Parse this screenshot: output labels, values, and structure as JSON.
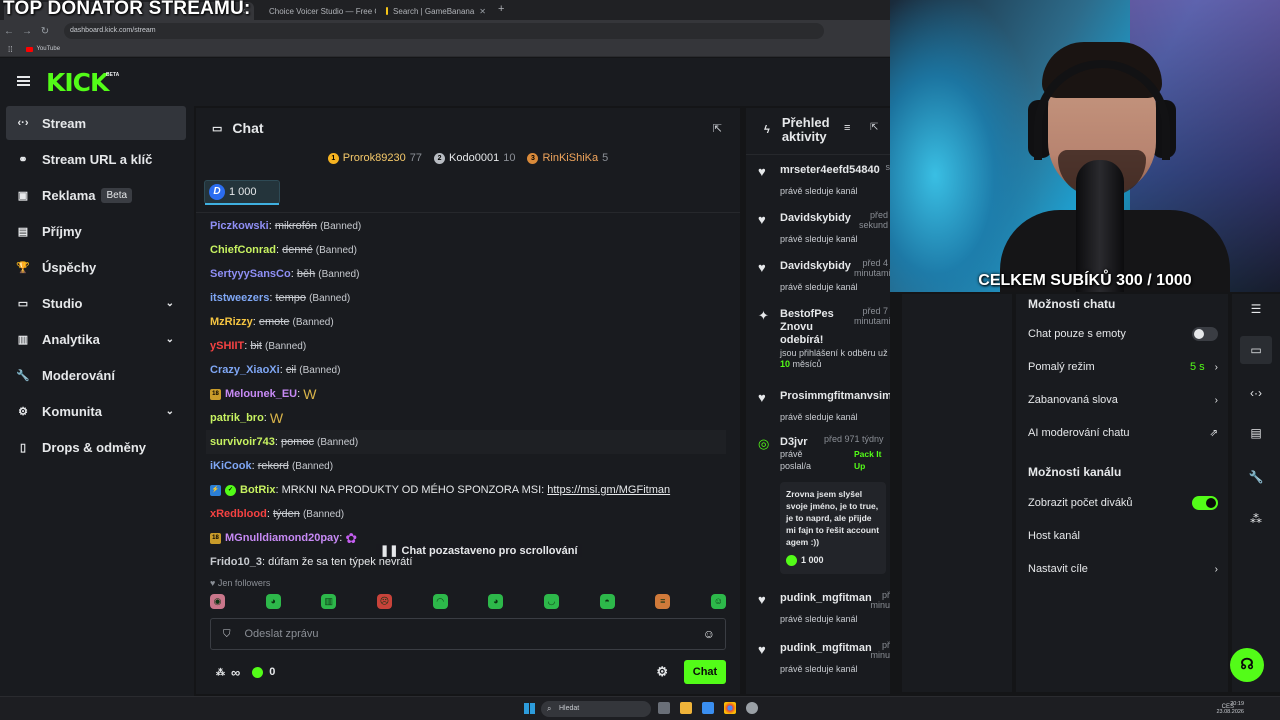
{
  "overlay": {
    "top_title": "TOP DONATOR STREAMU:",
    "subs_counter": "CELKEM SUBÍKŮ 300 / 1000"
  },
  "browser": {
    "tabs": [
      {
        "label": "",
        "active": true
      },
      {
        "label": "Choice Voicer Studio — Free C",
        "active": false
      },
      {
        "label": "Search | GameBanana",
        "active": false
      }
    ],
    "url": "dashboard.kick.com/stream",
    "bookmark": "YouTube"
  },
  "app": {
    "logo": "KICK",
    "logo_badge": "BETA"
  },
  "sidebar": {
    "items": [
      {
        "label": "Stream",
        "icon": "broadcast-icon",
        "glyph": "‹·›",
        "active": true
      },
      {
        "label": "Stream URL a klíč",
        "icon": "link-icon",
        "glyph": "⚭"
      },
      {
        "label": "Reklama",
        "icon": "ad-icon",
        "glyph": "▣",
        "badge": "Beta"
      },
      {
        "label": "Příjmy",
        "icon": "revenue-icon",
        "glyph": "▤"
      },
      {
        "label": "Úspěchy",
        "icon": "trophy-icon",
        "glyph": "🏆"
      },
      {
        "label": "Studio",
        "icon": "studio-icon",
        "glyph": "▭",
        "chevron": "⌄"
      },
      {
        "label": "Analytika",
        "icon": "analytics-icon",
        "glyph": "▥",
        "chevron": "⌄"
      },
      {
        "label": "Moderování",
        "icon": "wrench-icon",
        "glyph": "🔧"
      },
      {
        "label": "Komunita",
        "icon": "community-icon",
        "glyph": "⚙",
        "chevron": "⌄"
      },
      {
        "label": "Drops & odměny",
        "icon": "drops-icon",
        "glyph": "▯"
      }
    ]
  },
  "chat": {
    "title": "Chat",
    "top_gifters": [
      {
        "rank": "1",
        "name": "Prorok89230",
        "count": "77"
      },
      {
        "rank": "2",
        "name": "Kodo0001",
        "count": "10"
      },
      {
        "rank": "3",
        "name": "RinKiShiKa",
        "count": "5"
      }
    ],
    "pinned_amount": "1 000",
    "messages": [
      {
        "user": "Piczkowski",
        "color": "#8f8ff5",
        "text": "mikrofón",
        "status": "(Banned)"
      },
      {
        "user": "ChiefConrad",
        "color": "#c7f261",
        "text": "denné",
        "status": "(Banned)"
      },
      {
        "user": "SertyyySansCo",
        "color": "#8f8ff5",
        "text": "běh",
        "status": "(Banned)"
      },
      {
        "user": "itstweezers",
        "color": "#7fa7f5",
        "text": "tempo",
        "status": "(Banned)"
      },
      {
        "user": "MzRizzy",
        "color": "#f5c542",
        "text": "emote",
        "status": "(Banned)"
      },
      {
        "user": "ySHIIT",
        "color": "#f54242",
        "text": "bit",
        "status": "(Banned)"
      },
      {
        "user": "Crazy_XiaoXi",
        "color": "#7fa7f5",
        "text": "cil",
        "status": "(Banned)"
      },
      {
        "user": "Melounek_EU",
        "color": "#c78af5",
        "text": "",
        "status": "",
        "badge": "18",
        "emote": "W"
      },
      {
        "user": "patrik_bro",
        "color": "#c7f261",
        "text": "",
        "status": "",
        "emote": "W"
      },
      {
        "user": "survivoir743",
        "color": "#c7f261",
        "text": "pomoc",
        "status": "(Banned)",
        "highlight": true
      },
      {
        "user": "iKiCook",
        "color": "#7fa7f5",
        "text": "rekord",
        "status": "(Banned)"
      },
      {
        "user": "BotRix",
        "color": "#c7f261",
        "bot": true,
        "plain": "MRKNI NA PRODUKTY OD MÉHO SPONZORA MSI: ",
        "link": "https://msi.gm/MGFitman"
      },
      {
        "user": "xRedblood",
        "color": "#f54242",
        "text": "týden",
        "status": "(Banned)"
      },
      {
        "user": "MGnulldiamond20pay",
        "color": "#c78af5",
        "text": "",
        "status": "",
        "badge": "18",
        "emote": "✿"
      },
      {
        "user": "Frido10_3",
        "color": "#c8cbd0",
        "plain": "dúfam že sa ten týpek nevrátí"
      }
    ],
    "paused_notice": "Chat pozastaveno pro scrollování",
    "followers_mode": "Jen followers",
    "input_placeholder": "Odeslat zprávu",
    "infinity": "∞",
    "kick_coins": "0",
    "send_label": "Chat"
  },
  "activity": {
    "title": "Přehled aktivity",
    "items": [
      {
        "name": "mrseter4eefd54840",
        "time": "s",
        "sub": "právě sleduje kanál"
      },
      {
        "name": "Davidskybidy",
        "time": "před sekund",
        "sub": "právě sleduje kanál"
      },
      {
        "name": "Davidskybidy",
        "time": "před 4 minutami",
        "sub": "právě sleduje kanál"
      },
      {
        "name": "BestofPes Znovu odebírá!",
        "time": "před 7 minutami",
        "sub": "jsou přihlášení k odběru už 10 měsíců",
        "months": "10"
      },
      {
        "name": "Prosimmgfitmanvsim",
        "time": "",
        "sub": "právě sleduje kanál"
      },
      {
        "name": "D3jvr",
        "time": "před 971 týdny",
        "sub": "právě poslal/a",
        "reward": "Pack It Up",
        "message": "Zrovna jsem slyšel svoje jméno, je to true, je to naprd, ale přijde mi fajn to řešit account agem :))",
        "amount": "1 000"
      },
      {
        "name": "pudink_mgfitman",
        "time": "př minu",
        "sub": "právě sleduje kanál"
      },
      {
        "name": "pudink_mgfitman",
        "time": "př minu",
        "sub": "právě sleduje kanál"
      }
    ]
  },
  "settings": {
    "chat_heading": "Možnosti chatu",
    "emote_only": "Chat pouze s emoty",
    "slow_mode": "Pomalý režim",
    "slow_mode_value": "5 s",
    "banned_words": "Zabanovaná slova",
    "ai_moderation": "AI moderování chatu",
    "channel_heading": "Možnosti kanálu",
    "show_viewers": "Zobrazit počet diváků",
    "host_channel": "Host kanál",
    "set_goals": "Nastavit cíle"
  },
  "taskbar": {
    "search": "Hledat",
    "lang": "CES",
    "time": "20:19",
    "date": "23.08.2026"
  },
  "colors": {
    "accent": "#53fc18",
    "panel": "#191b1f",
    "background": "#141517"
  }
}
